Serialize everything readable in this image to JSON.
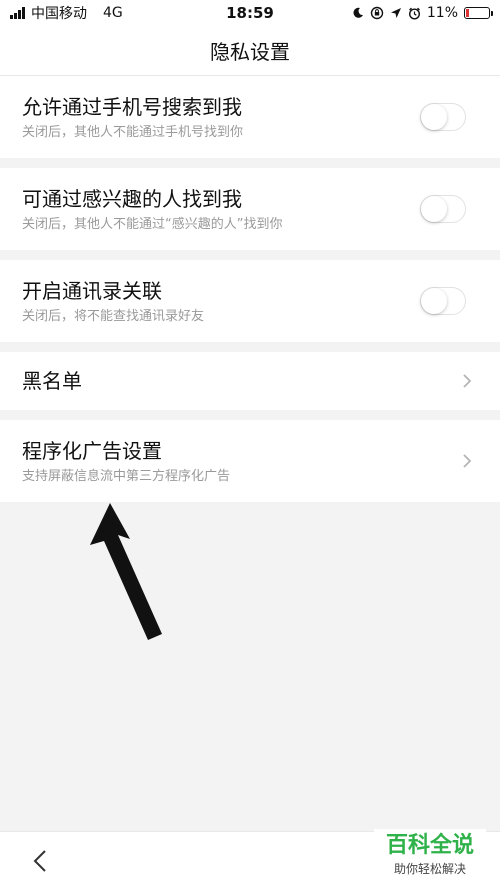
{
  "status_bar": {
    "carrier": "中国移动",
    "network": "4G",
    "time": "18:59",
    "battery": "11%"
  },
  "header": {
    "title": "隐私设置"
  },
  "settings": [
    {
      "title": "允许通过手机号搜索到我",
      "subtitle": "关闭后，其他人不能通过手机号找到你",
      "control": "toggle",
      "enabled": false
    },
    {
      "title": "可通过感兴趣的人找到我",
      "subtitle": "关闭后，其他人不能通过“感兴趣的人”找到你",
      "control": "toggle",
      "enabled": false
    },
    {
      "title": "开启通讯录关联",
      "subtitle": "关闭后，将不能查找通讯录好友",
      "control": "toggle",
      "enabled": false
    },
    {
      "title": "黑名单",
      "control": "chevron"
    },
    {
      "title": "程序化广告设置",
      "subtitle": "支持屏蔽信息流中第三方程序化广告",
      "control": "chevron"
    }
  ],
  "watermark": {
    "title": "百科全说",
    "subtitle": "助你轻松解决"
  },
  "colors": {
    "background": "#f3f3f3",
    "card": "#ffffff",
    "subtitle": "#9a9a9a",
    "watermark_green": "#2fb24a",
    "battery_low": "#d33333"
  },
  "icons": [
    "signal-icon",
    "moon-icon",
    "lock-rotation-icon",
    "location-icon",
    "alarm-icon",
    "battery-icon",
    "chevron-right-icon",
    "back-icon",
    "arrow-annotation-icon"
  ]
}
